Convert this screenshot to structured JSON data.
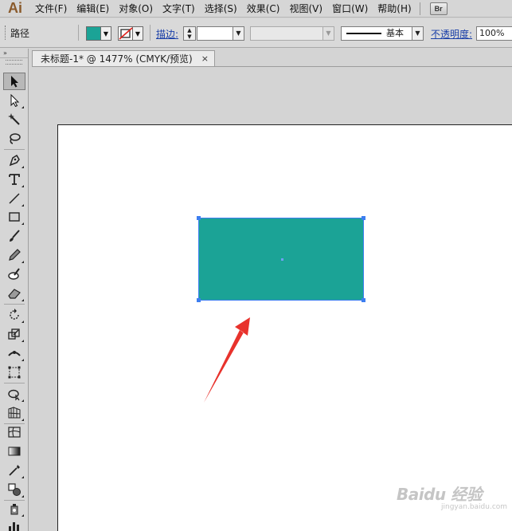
{
  "app": {
    "logo": "Ai",
    "bridge_label": "Br"
  },
  "menu": [
    "文件(F)",
    "编辑(E)",
    "对象(O)",
    "文字(T)",
    "选择(S)",
    "效果(C)",
    "视图(V)",
    "窗口(W)",
    "帮助(H)"
  ],
  "control_bar": {
    "selection_label": "路径",
    "stroke_label": "描边:",
    "brush_label": "基本",
    "opacity_label": "不透明度:",
    "opacity_value": "100%"
  },
  "document": {
    "tab_title": "未标题-1* @ 1477% (CMYK/预览)",
    "close_glyph": "×"
  },
  "toolbox": {
    "header": "»"
  },
  "artwork": {
    "fill_color": "#1ba396",
    "selection_color": "#3d7ef0",
    "annotation_arrow_color": "#e8322c"
  },
  "watermark": {
    "brand": "Baidu 经验",
    "url": "jingyan.baidu.com"
  }
}
